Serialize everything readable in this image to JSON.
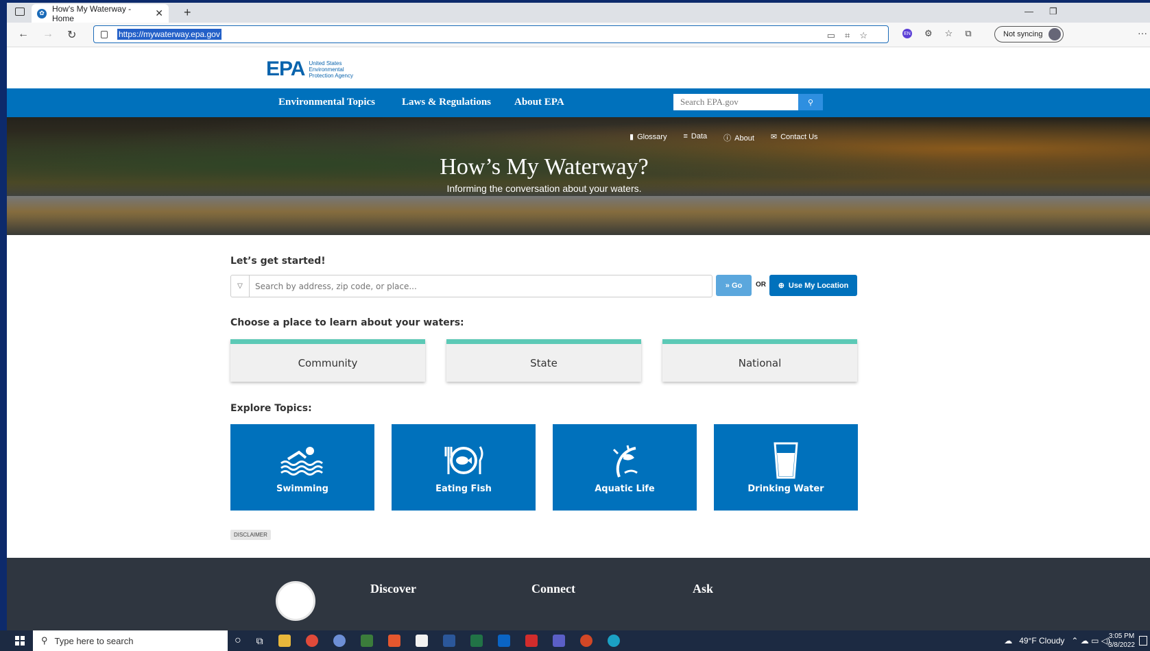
{
  "browser": {
    "tab_title": "How's My Waterway - Home",
    "url": "https://mywaterway.epa.gov",
    "sync_label": "Not syncing"
  },
  "epa": {
    "logo_text": "EPA",
    "logo_sub": "United States Environmental Protection Agency",
    "nav": [
      "Environmental Topics",
      "Laws & Regulations",
      "About EPA"
    ],
    "search_placeholder": "Search EPA.gov"
  },
  "hero": {
    "links": [
      "Glossary",
      "Data",
      "About",
      "Contact Us"
    ],
    "title": "How’s My Waterway?",
    "subtitle": "Informing the conversation about your waters."
  },
  "main": {
    "get_started": "Let’s get started!",
    "search_placeholder": "Search by address, zip code, or place...",
    "go_label": "» Go",
    "or_label": "OR",
    "location_label": "Use My Location",
    "choose_label": "Choose a place to learn about your waters:",
    "places": [
      "Community",
      "State",
      "National"
    ],
    "explore_label": "Explore Topics:",
    "topics": [
      "Swimming",
      "Eating Fish",
      "Aquatic Life",
      "Drinking Water"
    ],
    "disclaimer": "DISCLAIMER"
  },
  "footer": {
    "headings": [
      "Discover",
      "Connect",
      "Ask"
    ]
  },
  "taskbar": {
    "search_placeholder": "Type here to search",
    "weather": "49°F  Cloudy",
    "time": "3:05 PM",
    "date": "3/8/2022"
  }
}
